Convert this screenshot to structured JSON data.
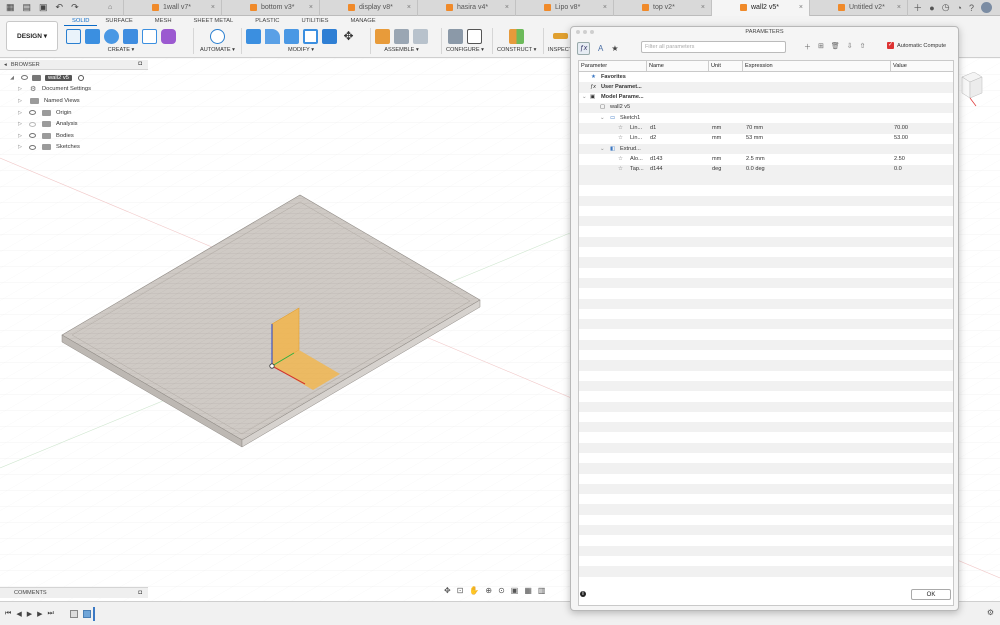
{
  "tabs": [
    {
      "label": "1wall v7*"
    },
    {
      "label": "bottom v3*"
    },
    {
      "label": "display v8*"
    },
    {
      "label": "hasira v4*"
    },
    {
      "label": "Lipo v8*"
    },
    {
      "label": "top v2*"
    },
    {
      "label": "wall2 v5*"
    },
    {
      "label": "Untitled v2*"
    }
  ],
  "active_tab_index": 6,
  "ribbon": {
    "workspace": "DESIGN ▾",
    "tabs": [
      "SOLID",
      "SURFACE",
      "MESH",
      "SHEET METAL",
      "PLASTIC",
      "UTILITIES",
      "MANAGE"
    ],
    "groups": [
      "CREATE ▾",
      "AUTOMATE ▾",
      "MODIFY ▾",
      "ASSEMBLE ▾",
      "CONFIGURE ▾",
      "CONSTRUCT ▾",
      "INSPECT"
    ]
  },
  "browser": {
    "title": "BROWSER",
    "root": "wall2 v5",
    "items": [
      "Document Settings",
      "Named Views",
      "Origin",
      "Analysis",
      "Bodies",
      "Sketches"
    ]
  },
  "comments": {
    "title": "COMMENTS"
  },
  "parameters": {
    "title": "PARAMETERS",
    "filter_placeholder": "Filter all parameters",
    "auto_compute": "Automatic Compute",
    "columns": [
      "Parameter",
      "Name",
      "Unit",
      "Expression",
      "Value"
    ],
    "rows": [
      {
        "param": "Favorites",
        "name": "",
        "unit": "",
        "expr": "",
        "value": ""
      },
      {
        "param": "User Paramet...",
        "name": "",
        "unit": "",
        "expr": "",
        "value": ""
      },
      {
        "param": "Model Parame...",
        "name": "",
        "unit": "",
        "expr": "",
        "value": ""
      },
      {
        "param": "wall2 v5",
        "name": "",
        "unit": "",
        "expr": "",
        "value": ""
      },
      {
        "param": "Sketch1",
        "name": "",
        "unit": "",
        "expr": "",
        "value": ""
      },
      {
        "param": "Lin...",
        "name": "d1",
        "unit": "mm",
        "expr": "70 mm",
        "value": "70.00"
      },
      {
        "param": "Lin...",
        "name": "d2",
        "unit": "mm",
        "expr": "53 mm",
        "value": "53.00"
      },
      {
        "param": "Extrud...",
        "name": "",
        "unit": "",
        "expr": "",
        "value": ""
      },
      {
        "param": "Alo...",
        "name": "d143",
        "unit": "mm",
        "expr": "2.5 mm",
        "value": "2.50"
      },
      {
        "param": "Tap...",
        "name": "d144",
        "unit": "deg",
        "expr": "0.0 deg",
        "value": "0.0"
      }
    ],
    "ok_label": "OK"
  },
  "viewcube": {
    "face": "FRONT"
  }
}
